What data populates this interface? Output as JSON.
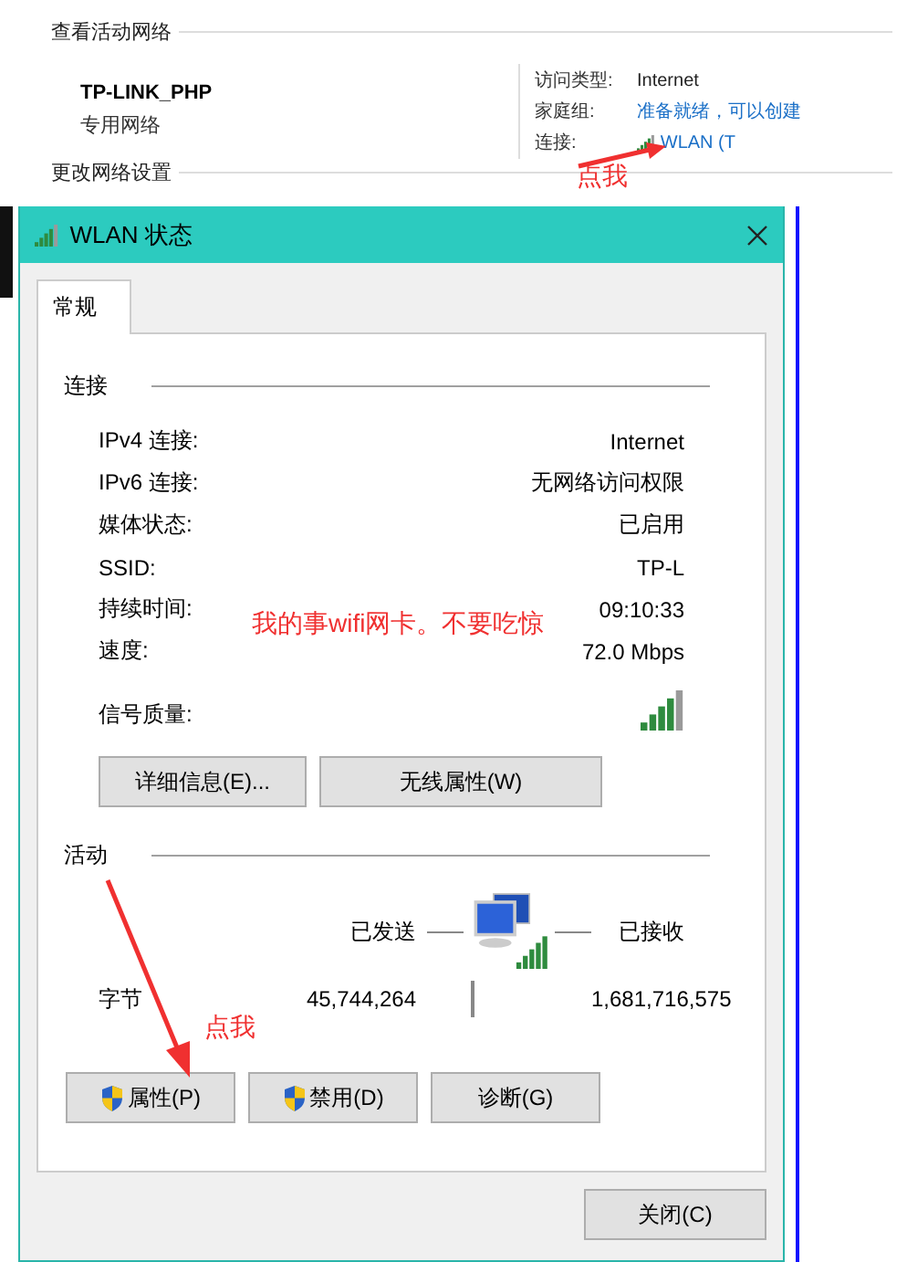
{
  "background": {
    "section_title": "查看活动网络",
    "network": {
      "name": "TP-LINK_PHP",
      "type": "专用网络"
    },
    "details": [
      {
        "label": "访问类型:",
        "value": "Internet",
        "kind": "text"
      },
      {
        "label": "家庭组:",
        "value": "准备就绪，可以创建",
        "kind": "link"
      },
      {
        "label": "连接:",
        "value": "WLAN (T",
        "kind": "wifi-link"
      }
    ],
    "change_title": "更改网络设置"
  },
  "annotations": [
    {
      "text": "点我"
    },
    {
      "text": "我的事wifi网卡。不要吃惊"
    },
    {
      "text": "点我"
    }
  ],
  "dialog": {
    "title": "WLAN 状态",
    "tabs": [
      {
        "label": "常规",
        "selected": true
      }
    ],
    "connection": {
      "heading": "连接",
      "rows": [
        {
          "label": "IPv4 连接:",
          "value": "Internet",
          "kind": "text"
        },
        {
          "label": "IPv6 连接:",
          "value": "无网络访问权限",
          "kind": "text"
        },
        {
          "label": "媒体状态:",
          "value": "已启用",
          "kind": "text"
        },
        {
          "label": "SSID:",
          "value": "TP-L",
          "kind": "text"
        },
        {
          "label": "持续时间:",
          "value": "09:10:33",
          "kind": "text"
        },
        {
          "label": "速度:",
          "value": "72.0 Mbps",
          "kind": "text"
        },
        {
          "label": "信号质量:",
          "kind": "signal"
        }
      ]
    },
    "connection_buttons": [
      {
        "label": "详细信息(E)..."
      },
      {
        "label": "无线属性(W)"
      }
    ],
    "activity": {
      "heading": "活动",
      "sent_label": "已发送",
      "received_label": "已接收",
      "bytes_label": "字节",
      "sent": "45,744,264",
      "received": "1,681,716,575"
    },
    "action_buttons": [
      {
        "label": "属性(P)",
        "shield": true
      },
      {
        "label": "禁用(D)",
        "shield": true
      },
      {
        "label": "诊断(G)",
        "shield": false
      }
    ],
    "close_button": "关闭(C)"
  }
}
